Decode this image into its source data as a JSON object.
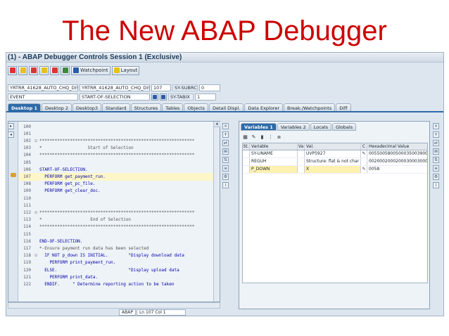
{
  "slide": {
    "title": "The New ABAP Debugger"
  },
  "window": {
    "title": "(1) - ABAP Debugger Controls Session 1 (Exclusive)"
  },
  "toolbar": {
    "watchpoint_label": "Watchpoint",
    "layout_label": "Layout"
  },
  "info": {
    "row1": {
      "program": "YRTRR_41628_AUTO_CHQ_DISBRS",
      "include": "YRTRR_41628_AUTO_CHQ_DISBRS",
      "line": "107",
      "sy_label": "SY-SUBRC",
      "sy_value": "0"
    },
    "row2": {
      "program": "EVENT",
      "include": "START-OF-SELECTION",
      "sy_label": "SY-TABIX",
      "sy_value": "1"
    }
  },
  "tabs": [
    "Desktop 1",
    "Desktop 2",
    "Desktop3",
    "Standard",
    "Structures",
    "Tables",
    "Objects",
    "Detail Displ.",
    "Data Explorer",
    "Break./Watchpoints",
    "Diff"
  ],
  "code": [
    {
      "ln": "100",
      "mk": "",
      "tx": ""
    },
    {
      "ln": "101",
      "mk": "",
      "tx": ""
    },
    {
      "ln": "102",
      "mk": "⊟",
      "tx": "*************************************************************"
    },
    {
      "ln": "103",
      "mk": "",
      "tx": "*                  Start of Selection"
    },
    {
      "ln": "104",
      "mk": "",
      "tx": "*************************************************************"
    },
    {
      "ln": "105",
      "mk": "",
      "tx": ""
    },
    {
      "ln": "106",
      "mk": "",
      "tx": "START-OF-SELECTION."
    },
    {
      "ln": "107",
      "mk": "",
      "tx": "  PERFORM get_payment_run."
    },
    {
      "ln": "108",
      "mk": "",
      "tx": "  PERFORM get_pc_file."
    },
    {
      "ln": "109",
      "mk": "",
      "tx": "  PERFORM get_clear_doc."
    },
    {
      "ln": "110",
      "mk": "",
      "tx": ""
    },
    {
      "ln": "111",
      "mk": "",
      "tx": ""
    },
    {
      "ln": "112",
      "mk": "⊟",
      "tx": "*************************************************************"
    },
    {
      "ln": "113",
      "mk": "",
      "tx": "*                   End of Selection"
    },
    {
      "ln": "114",
      "mk": "",
      "tx": "*************************************************************"
    },
    {
      "ln": "115",
      "mk": "",
      "tx": ""
    },
    {
      "ln": "116",
      "mk": "",
      "tx": "END-OF-SELECTION."
    },
    {
      "ln": "117",
      "mk": "",
      "tx": "*-Ensure payment run data has been selected"
    },
    {
      "ln": "118",
      "mk": "⊟",
      "tx": "  IF NOT p_down IS INITIAL.        \"Display download data"
    },
    {
      "ln": "119",
      "mk": "",
      "tx": "    PERFORM print_payment_run."
    },
    {
      "ln": "120",
      "mk": "",
      "tx": "  ELSE.                            \"Display upload data"
    },
    {
      "ln": "121",
      "mk": "",
      "tx": "    PERFORM print_data."
    },
    {
      "ln": "122",
      "mk": "",
      "tx": "  ENDIF.     \" Determine reporting action to be taken"
    }
  ],
  "status": {
    "lang": "ABAP",
    "pos": "Ln 107 Col  1"
  },
  "var_tabs": [
    "Variables 1",
    "Variables 2",
    "Locals",
    "Globals"
  ],
  "grid": {
    "headers": {
      "st": "St.",
      "var": "Variable",
      "va": "Va",
      "val": "Val.",
      "c": "C",
      "hex": "Hexadecimal Value"
    },
    "rows": [
      {
        "var": "SY-UNAME",
        "val": "UVP5927",
        "c": "✎",
        "hex": "00550058005000350039003200"
      },
      {
        "var": "REGUH",
        "val": "Structure: flat & not char",
        "c": "",
        "hex": "00200020002000300030003000"
      },
      {
        "var": "P_DOWN",
        "val": "X",
        "c": "✎",
        "hex": "0058"
      }
    ]
  }
}
